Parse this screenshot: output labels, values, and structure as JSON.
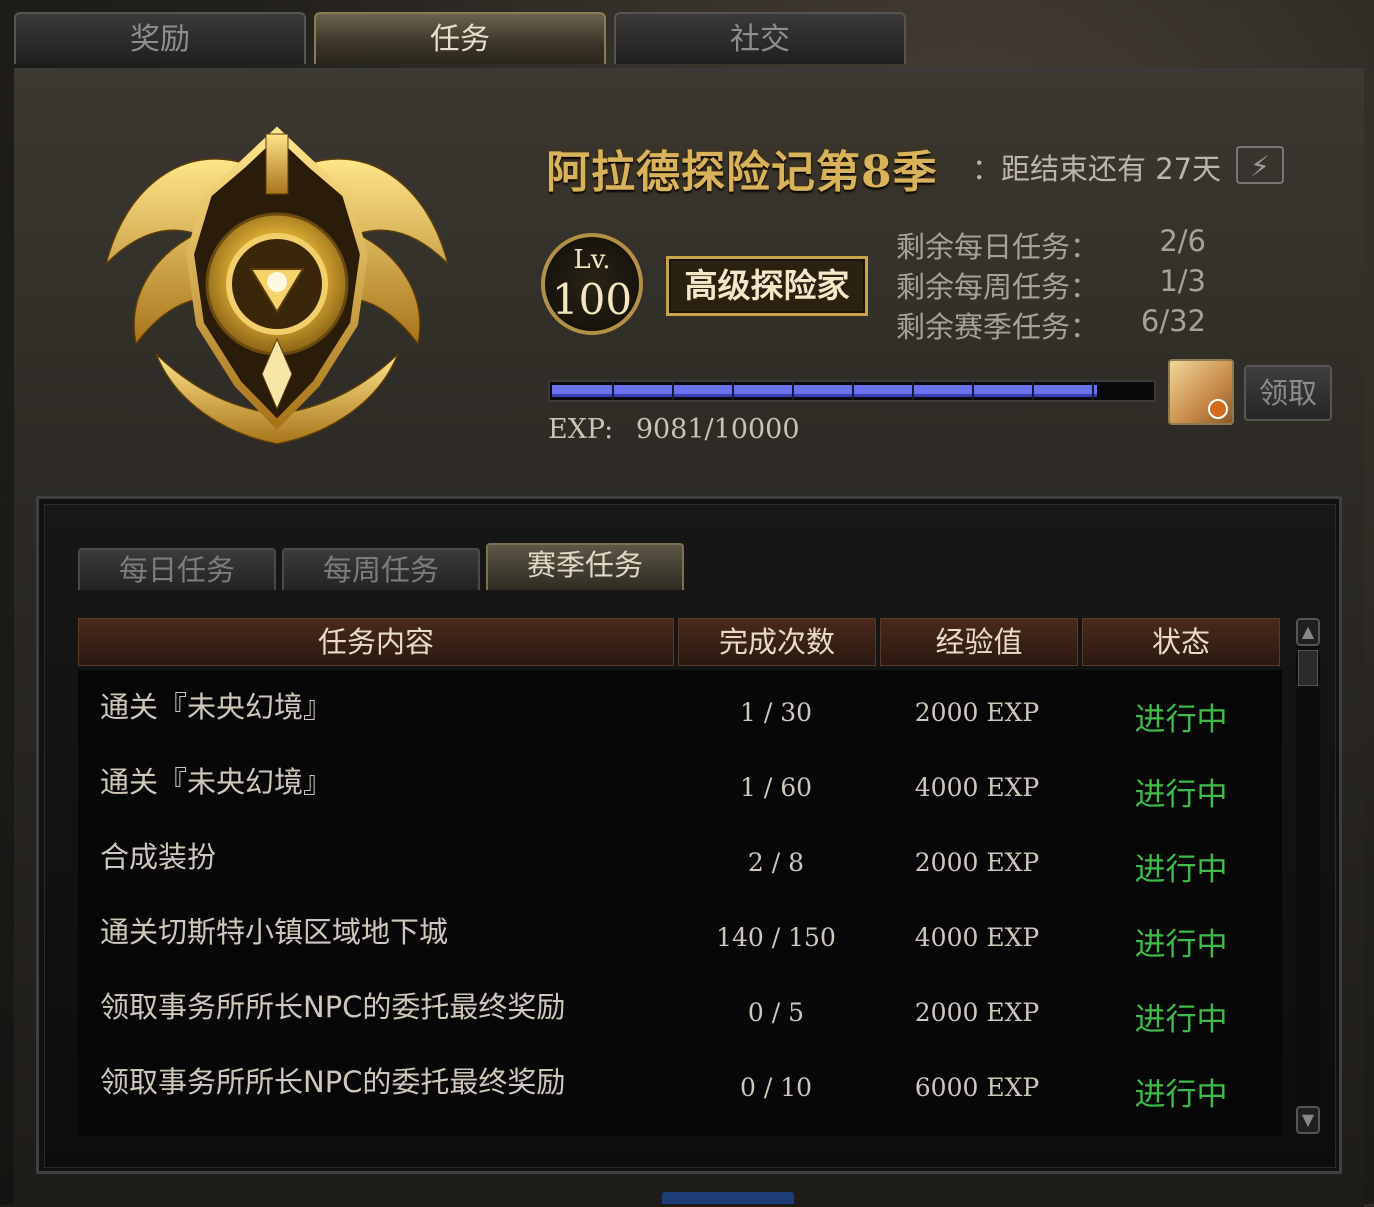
{
  "top_tabs": [
    {
      "label": "奖励",
      "active": false
    },
    {
      "label": "任务",
      "active": true
    },
    {
      "label": "社交",
      "active": false
    }
  ],
  "season": {
    "title": "阿拉德探险记第8季",
    "remaining_time": "：距结束还有 27天"
  },
  "level": {
    "prefix": "Lv.",
    "value": "100"
  },
  "rank_label": "高级探险家",
  "remaining_tasks": [
    {
      "label": "剩余每日任务：",
      "value": "2/6"
    },
    {
      "label": "剩余每周任务：",
      "value": "1/3"
    },
    {
      "label": "剩余赛季任务：",
      "value": "6/32"
    }
  ],
  "exp": {
    "label": "EXP:",
    "text": "9081/10000",
    "current": 9081,
    "max": 10000
  },
  "claim_button": "领取",
  "sub_tabs": [
    {
      "label": "每日任务",
      "active": false
    },
    {
      "label": "每周任务",
      "active": false
    },
    {
      "label": "赛季任务",
      "active": true
    }
  ],
  "table": {
    "headers": [
      "任务内容",
      "完成次数",
      "经验值",
      "状态"
    ],
    "rows": [
      {
        "name": "通关『未央幻境』",
        "count": "1 / 30",
        "exp": "2000 EXP",
        "status": "进行中"
      },
      {
        "name": "通关『未央幻境』",
        "count": "1 / 60",
        "exp": "4000 EXP",
        "status": "进行中"
      },
      {
        "name": "合成装扮",
        "count": "2 / 8",
        "exp": "2000 EXP",
        "status": "进行中"
      },
      {
        "name": "通关切斯特小镇区域地下城",
        "count": "140 / 150",
        "exp": "4000 EXP",
        "status": "进行中"
      },
      {
        "name": "领取事务所所长NPC的委托最终奖励",
        "count": "0 / 5",
        "exp": "2000 EXP",
        "status": "进行中"
      },
      {
        "name": "领取事务所所长NPC的委托最终奖励",
        "count": "0 / 10",
        "exp": "6000 EXP",
        "status": "进行中"
      }
    ]
  },
  "colors": {
    "title_gold": "#d8b35a",
    "status_green": "#3fbb4a",
    "exp_bar": "#6a72f0"
  },
  "icons": {
    "emblem": "golden-winged-emblem-icon",
    "gift": "gift-box-icon",
    "bolt": "lightning-icon",
    "scroll_up": "arrow-up-icon",
    "scroll_down": "arrow-down-icon"
  }
}
